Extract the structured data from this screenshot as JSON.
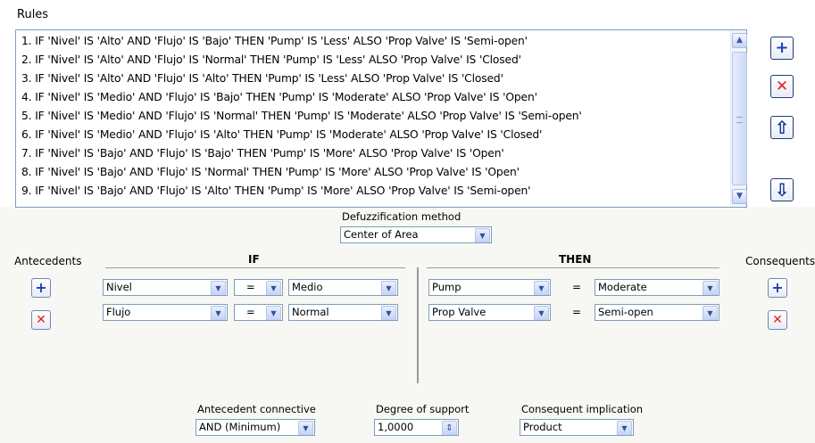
{
  "rules": {
    "title": "Rules",
    "items": [
      "1. IF 'Nivel' IS 'Alto' AND 'Flujo' IS 'Bajo' THEN 'Pump' IS 'Less' ALSO 'Prop Valve' IS 'Semi-open'",
      "2. IF 'Nivel' IS 'Alto' AND 'Flujo' IS 'Normal' THEN 'Pump' IS 'Less' ALSO 'Prop Valve' IS 'Closed'",
      "3. IF 'Nivel' IS 'Alto' AND 'Flujo' IS 'Alto' THEN 'Pump' IS 'Less' ALSO 'Prop Valve' IS 'Closed'",
      "4. IF 'Nivel' IS 'Medio' AND 'Flujo' IS 'Bajo' THEN 'Pump' IS 'Moderate' ALSO 'Prop Valve' IS 'Open'",
      "5. IF 'Nivel' IS 'Medio' AND 'Flujo' IS 'Normal' THEN 'Pump' IS 'Moderate' ALSO 'Prop Valve' IS 'Semi-open'",
      "6. IF 'Nivel' IS 'Medio' AND 'Flujo' IS 'Alto' THEN 'Pump' IS 'Moderate' ALSO 'Prop Valve' IS 'Closed'",
      "7. IF 'Nivel' IS 'Bajo' AND 'Flujo' IS 'Bajo' THEN 'Pump' IS 'More' ALSO 'Prop Valve' IS 'Open'",
      "8. IF 'Nivel' IS 'Bajo' AND 'Flujo' IS 'Normal' THEN 'Pump' IS 'More' ALSO 'Prop Valve' IS 'Open'",
      "9. IF 'Nivel' IS 'Bajo' AND 'Flujo' IS 'Alto' THEN 'Pump' IS 'More' ALSO 'Prop Valve' IS 'Semi-open'"
    ]
  },
  "rule_buttons": {
    "add": {
      "glyph": "+",
      "icon": "plus-icon"
    },
    "remove": {
      "glyph": "✕",
      "icon": "x-icon"
    },
    "move_up": {
      "glyph": "⇧",
      "icon": "arrow-up-icon"
    },
    "move_down": {
      "glyph": "⇩",
      "icon": "arrow-down-icon"
    }
  },
  "scroll": {
    "up": "▲",
    "down": "▼"
  },
  "combo_arrow": "▼",
  "defuzzification": {
    "label": "Defuzzification method",
    "value": "Center of Area"
  },
  "antecedents": {
    "label": "Antecedents",
    "header": "IF",
    "rows": [
      {
        "variable": "Nivel",
        "operator": "=",
        "term": "Medio"
      },
      {
        "variable": "Flujo",
        "operator": "=",
        "term": "Normal"
      }
    ]
  },
  "consequents": {
    "label": "Consequents",
    "header": "THEN",
    "rows": [
      {
        "variable": "Pump",
        "operator": "=",
        "term": "Moderate"
      },
      {
        "variable": "Prop Valve",
        "operator": "=",
        "term": "Semi-open"
      }
    ]
  },
  "antecedent_connective": {
    "label": "Antecedent connective",
    "value": "AND (Minimum)"
  },
  "degree_of_support": {
    "label": "Degree of support",
    "value": "1,0000",
    "spin": "⇕"
  },
  "consequent_implication": {
    "label": "Consequent implication",
    "value": "Product"
  },
  "colors": {
    "accent": "#1a3fbf",
    "remove": "#e02020",
    "border": "#7f9db9",
    "panel": "#f7f7f4"
  }
}
